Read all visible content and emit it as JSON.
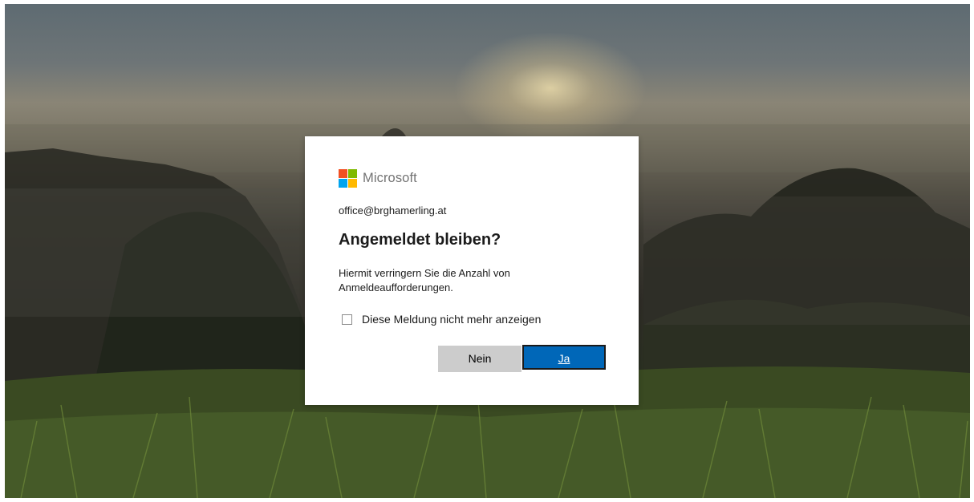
{
  "brand": {
    "name": "Microsoft",
    "squares": [
      "#f25022",
      "#7fba00",
      "#00a4ef",
      "#ffb900"
    ]
  },
  "identity": {
    "email": "office@brghamerling.at"
  },
  "dialog": {
    "title": "Angemeldet bleiben?",
    "description": "Hiermit verringern Sie die Anzahl von Anmeldeaufforderungen.",
    "checkbox_label": "Diese Meldung nicht mehr anzeigen",
    "checkbox_checked": false
  },
  "buttons": {
    "no_label": "Nein",
    "yes_label": "Ja"
  },
  "colors": {
    "primary": "#0067b8",
    "secondary_button": "#cccccc"
  }
}
